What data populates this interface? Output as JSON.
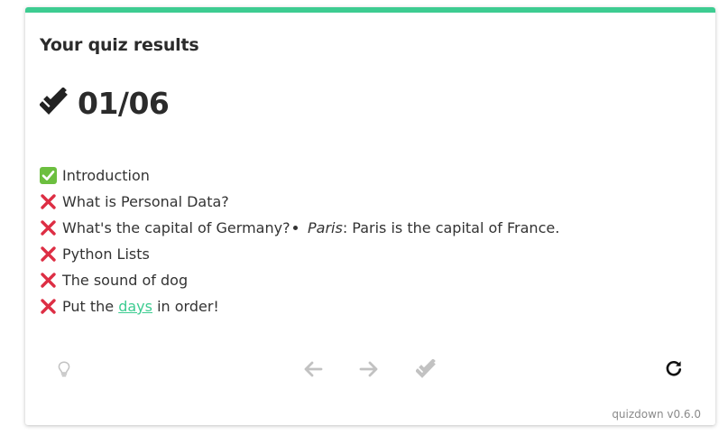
{
  "quiz": {
    "heading": "Your quiz results",
    "score": "01/06",
    "questions": [
      {
        "status": "correct",
        "prefix": "Introduction",
        "link": "",
        "suffix": ""
      },
      {
        "status": "wrong",
        "prefix": "What is Personal Data?",
        "link": "",
        "suffix": ""
      },
      {
        "status": "wrong",
        "prefix": "What's the capital of Germany?",
        "link": "",
        "suffix": ""
      },
      {
        "status": "wrong",
        "prefix": "Python Lists",
        "link": "",
        "suffix": ""
      },
      {
        "status": "wrong",
        "prefix": "The sound of dog",
        "link": "",
        "suffix": ""
      },
      {
        "status": "wrong",
        "prefix": "Put the ",
        "link": "days",
        "suffix": " in order!"
      }
    ],
    "feedback": {
      "answer": "Paris",
      "separator": ": ",
      "explanation": "Paris is the capital of France."
    }
  },
  "controls": {
    "hint_icon": "lightbulb-icon",
    "prev_icon": "arrow-left-icon",
    "next_icon": "arrow-right-icon",
    "check_icon": "double-check-icon",
    "restart_icon": "restart-icon"
  },
  "footer": {
    "version": "quizdown v0.6.0"
  },
  "colors": {
    "accent": "#3dcc91",
    "correct": "#6cbf3f",
    "wrong": "#dd2e44",
    "disabled": "#c2c2c2"
  }
}
